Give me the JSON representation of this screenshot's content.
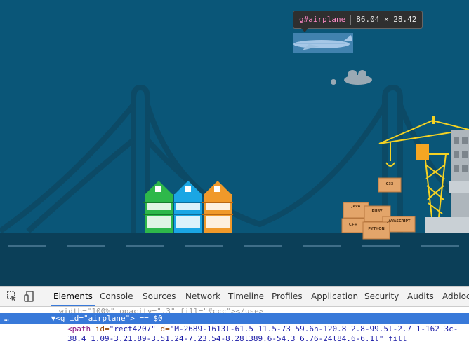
{
  "tooltip": {
    "tag": "g",
    "id": "#airplane",
    "dimensions": "86.04 × 28.42"
  },
  "scene": {
    "crate_labels": [
      "C33",
      "JAVA",
      "RUBY",
      "JAVASCRIPT",
      "C++",
      "PYTHON"
    ],
    "colors": {
      "sky": "#0a5678",
      "bridge": "#0c4a66",
      "ground": "#0b3f58",
      "crane": "#f5d223",
      "house_green": "#2eb84a",
      "house_blue": "#1aa6e4",
      "house_orange": "#f0992a",
      "crate": "#e3a56a"
    }
  },
  "devtools": {
    "tabs": [
      "Elements",
      "Console",
      "Sources",
      "Network",
      "Timeline",
      "Profiles",
      "Application",
      "Security",
      "Audits",
      "Adbloc"
    ],
    "active_tab": "Elements",
    "icons": [
      "inspect-icon",
      "device-toggle-icon"
    ],
    "code_line1": "width=\"100%\" opacity=\".3\" fill=\"#ccc\"></use>",
    "code_line2_prefix": "…",
    "code_line2_tag_open": "<g ",
    "code_line2_attr": "id=",
    "code_line2_val": "\"airplane\"",
    "code_line2_suffix": "> == $0",
    "code_line3_tag": "<path ",
    "code_line3_attr1": "id=",
    "code_line3_val1": "\"rect4207\"",
    "code_line3_attr2": " d=",
    "code_line3_val2": "\"M-2689-1613l-61.5 11.5-73 59.6h-120.8 2.8-99.5l-2.7 1-162 3c-",
    "code_line4": "38.4 1.09-3.21.89-3.51.24-7.23.54-8.28l389.6-54.3 6.76-24l84.6-6.1l\" fill"
  }
}
